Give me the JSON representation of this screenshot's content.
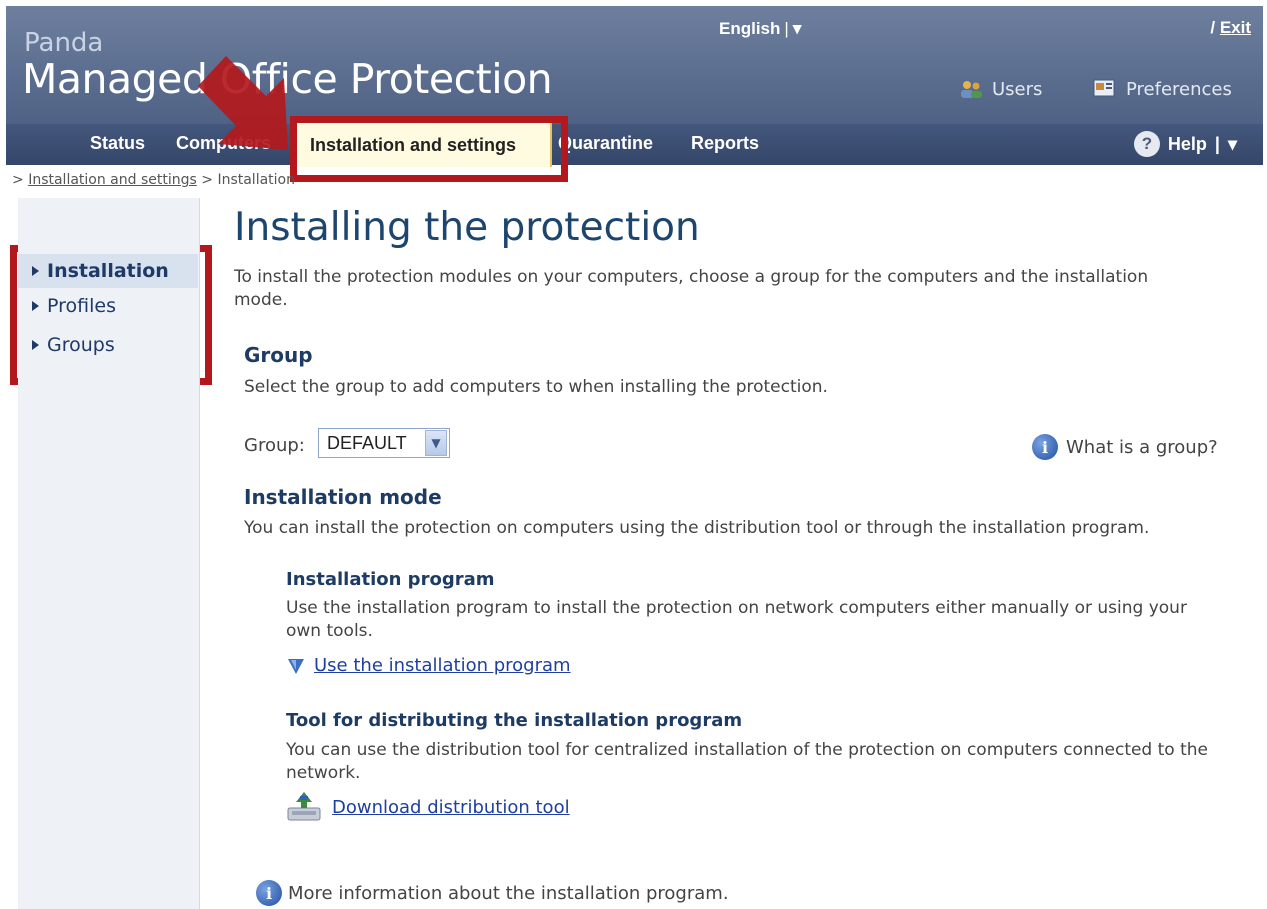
{
  "header": {
    "brand_small": "Panda",
    "brand_big": "Managed Office Protection",
    "language": "English",
    "language_sep": "|",
    "exit_label": "Exit",
    "exit_prefix": "/",
    "users_label": "Users",
    "preferences_label": "Preferences"
  },
  "nav": {
    "status": "Status",
    "computers": "Computers",
    "installation": "Installation and settings",
    "quarantine": "Quarantine",
    "reports": "Reports",
    "help": "Help",
    "help_sep": "|"
  },
  "breadcrumb": {
    "prefix": ">",
    "link": "Installation and settings",
    "sep": ">",
    "current": "Installation"
  },
  "sidebar": {
    "items": [
      {
        "label": "Installation",
        "active": true
      },
      {
        "label": "Profiles",
        "active": false
      },
      {
        "label": "Groups",
        "active": false
      }
    ]
  },
  "main": {
    "title": "Installing the protection",
    "intro": "To install the protection modules on your computers, choose a group for the computers and the installation mode.",
    "group_heading": "Group",
    "group_desc": "Select the group to add computers to when installing the protection.",
    "group_label": "Group:",
    "group_value": "DEFAULT",
    "what_is_group": "What is a group?",
    "mode_heading": "Installation mode",
    "mode_desc": "You can install the protection on computers using the distribution tool or through the installation program.",
    "program_heading": "Installation program",
    "program_desc": "Use the installation program to install the protection on network computers either manually or using your own tools.",
    "program_link": "Use the installation program",
    "tool_heading": "Tool for distributing the installation program",
    "tool_desc": "You can use the distribution tool for centralized installation of the protection on computers connected to the network.",
    "tool_link": "Download distribution tool",
    "more_info": "More information about the installation program."
  },
  "colors": {
    "header_bg": "#5d6f90",
    "nav_bg": "#3c4f74",
    "highlight_red": "#b3191c",
    "title_blue": "#1e456e",
    "link_blue": "#1e3fa0"
  },
  "icons": [
    "users-icon",
    "preferences-icon",
    "help-icon",
    "dropdown-arrow-icon",
    "info-icon",
    "download-icon",
    "expand-triangle-icon"
  ]
}
